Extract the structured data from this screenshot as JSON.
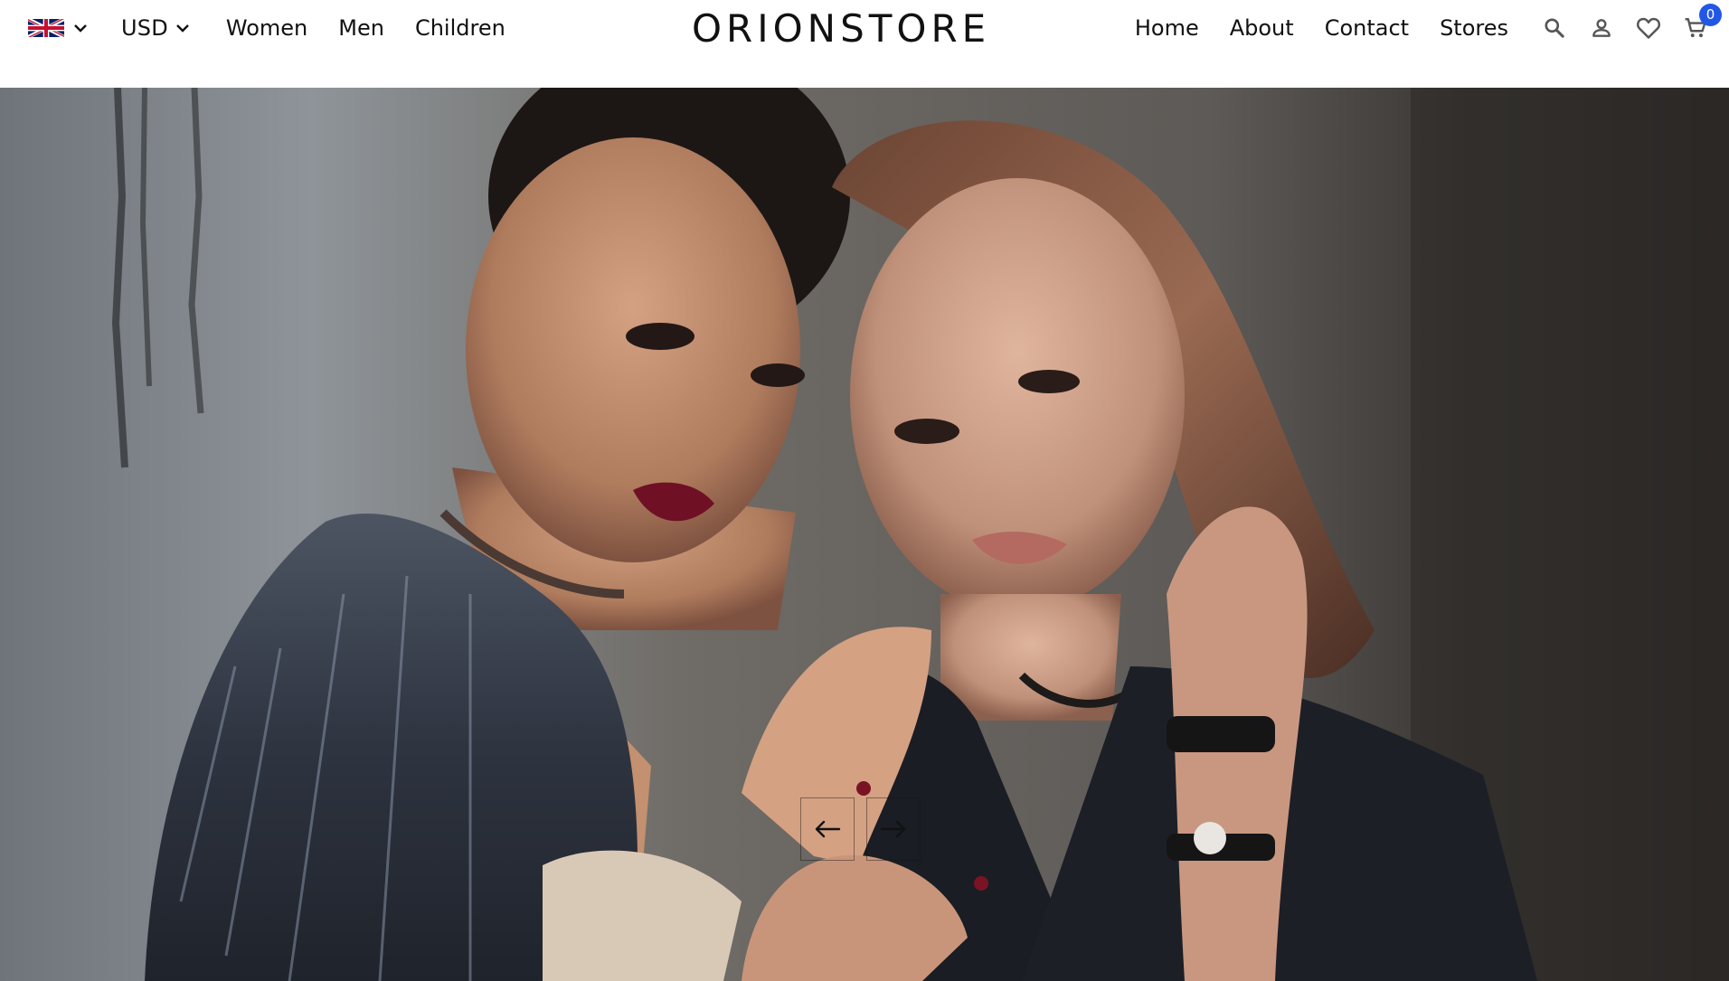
{
  "header": {
    "language": {
      "icon": "uk-flag-icon",
      "label": "English"
    },
    "currency": {
      "value": "USD"
    },
    "nav_left": [
      {
        "label": "Women"
      },
      {
        "label": "Men"
      },
      {
        "label": "Children"
      }
    ],
    "logo": "ORIONSTORE",
    "nav_right": [
      {
        "label": "Home"
      },
      {
        "label": "About"
      },
      {
        "label": "Contact"
      },
      {
        "label": "Stores"
      }
    ],
    "icons": [
      "search-icon",
      "account-icon",
      "wishlist-icon",
      "cart-icon"
    ],
    "cart_count": "0",
    "colors": {
      "badge": "#2257e6",
      "text": "#111111"
    }
  },
  "hero": {
    "image": "two-models-fashion-photo",
    "controls": {
      "prev_icon": "arrow-left-icon",
      "next_icon": "arrow-right-icon"
    }
  }
}
